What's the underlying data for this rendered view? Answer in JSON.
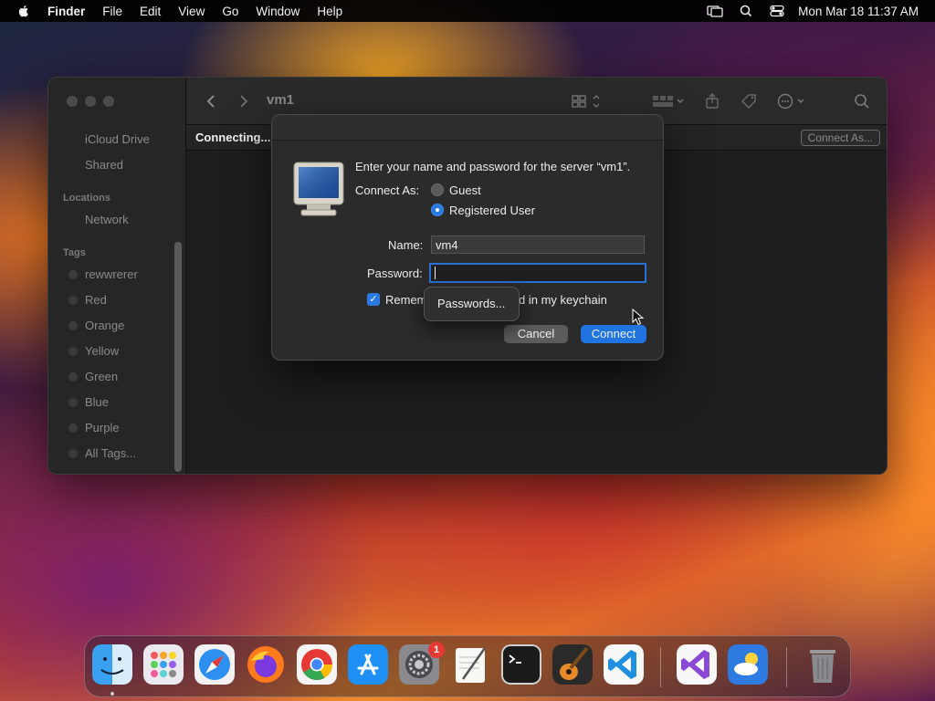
{
  "menubar": {
    "app_name": "Finder",
    "items": [
      "File",
      "Edit",
      "View",
      "Go",
      "Window",
      "Help"
    ],
    "clock": "Mon Mar 18  11:37 AM"
  },
  "finder": {
    "title": "vm1",
    "status": "Connecting...",
    "connect_as_button": "Connect As...",
    "sidebar": {
      "favorites": [
        "iCloud Drive",
        "Shared"
      ],
      "locations_header": "Locations",
      "locations": [
        "Network"
      ],
      "tags_header": "Tags",
      "tags": [
        "rewwrerer",
        "Red",
        "Orange",
        "Yellow",
        "Green",
        "Blue",
        "Purple",
        "All Tags..."
      ]
    }
  },
  "dialog": {
    "prompt": "Enter your name and password for the server “vm1”.",
    "connect_as_label": "Connect As:",
    "option_guest": "Guest",
    "option_registered": "Registered User",
    "selected_option": "Registered User",
    "name_label": "Name:",
    "name_value": "vm4",
    "password_label": "Password:",
    "password_value": "",
    "remember_prefix": "Remem",
    "remember_suffix": "d in my keychain",
    "remember_checked": true,
    "cancel_label": "Cancel",
    "connect_label": "Connect",
    "popover_label": "Passwords..."
  },
  "dock": {
    "apps": [
      "Finder",
      "Launchpad",
      "Safari",
      "Firefox",
      "Chrome",
      "App Store",
      "System Settings",
      "TextEdit",
      "Terminal",
      "GarageBand",
      "Visual Studio Code",
      "Visual Studio",
      "Weather",
      "Trash"
    ],
    "system_settings_badge": "1"
  },
  "colors": {
    "accent": "#1f74e0",
    "badge": "#e53935"
  }
}
